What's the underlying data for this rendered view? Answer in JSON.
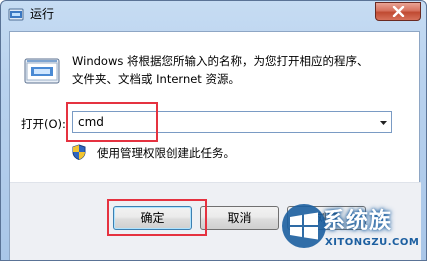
{
  "window": {
    "title": "运行"
  },
  "description": {
    "line1": "Windows 将根据您所输入的名称，为您打开相应的程序、",
    "line2": "文件夹、文档或 Internet 资源。"
  },
  "open_field": {
    "label": "打开(O):",
    "value": "cmd"
  },
  "admin_note": "使用管理权限创建此任务。",
  "buttons": {
    "ok": "确定",
    "cancel": "取消",
    "browse": "浏览"
  },
  "watermark": {
    "text": "系统族",
    "subtext": "XITONGZU.COM"
  },
  "colors": {
    "highlight": "#e53240",
    "title_gradient": "#b9d2ee",
    "close_button": "#c04a32"
  }
}
